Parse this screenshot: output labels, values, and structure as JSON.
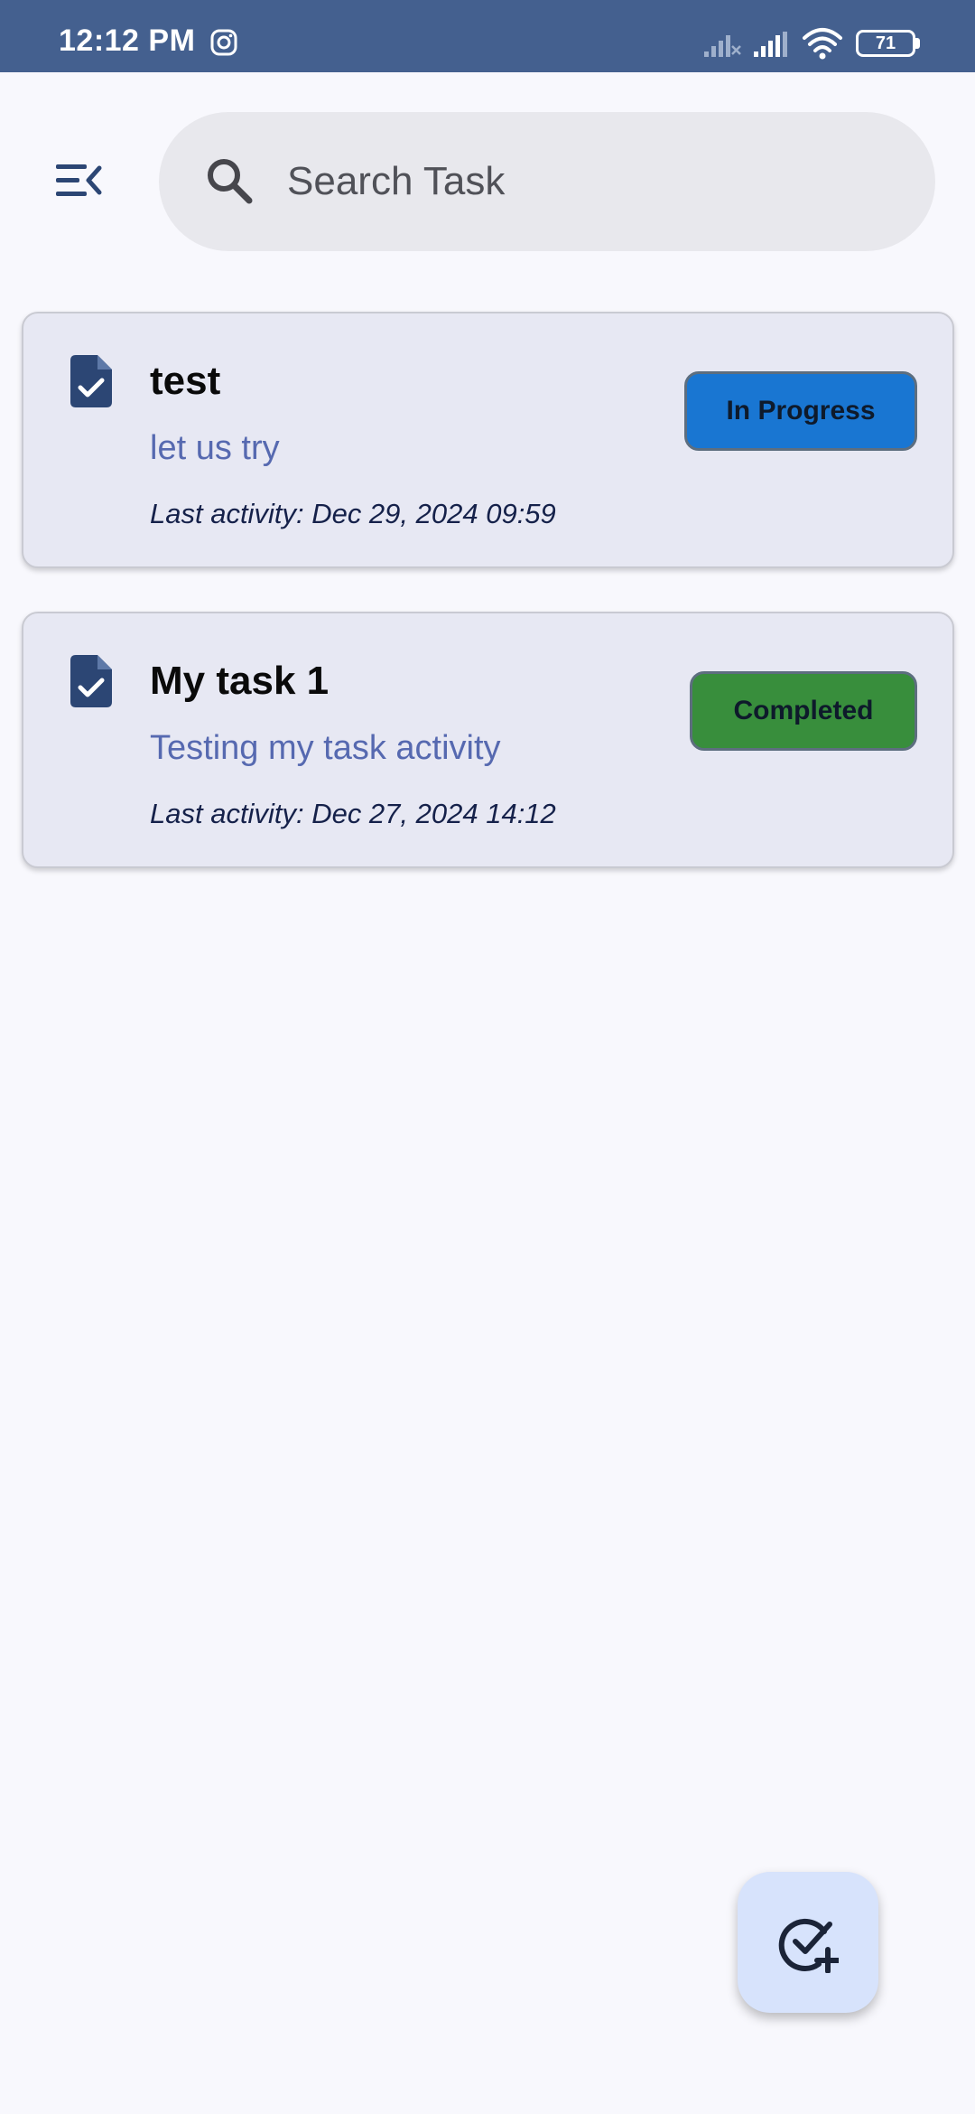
{
  "status_bar": {
    "time": "12:12 PM",
    "battery": "71",
    "icons": [
      "instagram-icon",
      "signal-icon",
      "signal-icon",
      "wifi-icon",
      "battery-icon"
    ]
  },
  "header": {
    "menu_icon": "menu-collapse-icon",
    "search": {
      "placeholder": "Search Task",
      "value": "",
      "icon": "search-icon"
    }
  },
  "tasks": [
    {
      "title": "test",
      "description": "let us try",
      "activity_label": "Last activity:",
      "activity_time": "Dec 29, 2024 09:59",
      "status": "In Progress",
      "status_color": "#1976D2",
      "icon": "task-document-icon"
    },
    {
      "title": "My task 1",
      "description": "Testing my task activity",
      "activity_label": "Last activity:",
      "activity_time": "Dec 27, 2024 14:12",
      "status": "Completed",
      "status_color": "#388E3C",
      "icon": "task-document-icon"
    }
  ],
  "fab": {
    "icon": "add-task-icon"
  },
  "colors": {
    "status_bar": "#44608F",
    "background": "#F8F8FD",
    "card": "#E7E8F3",
    "accent_icon": "#2C4674",
    "fab": "#D7E3FC"
  }
}
